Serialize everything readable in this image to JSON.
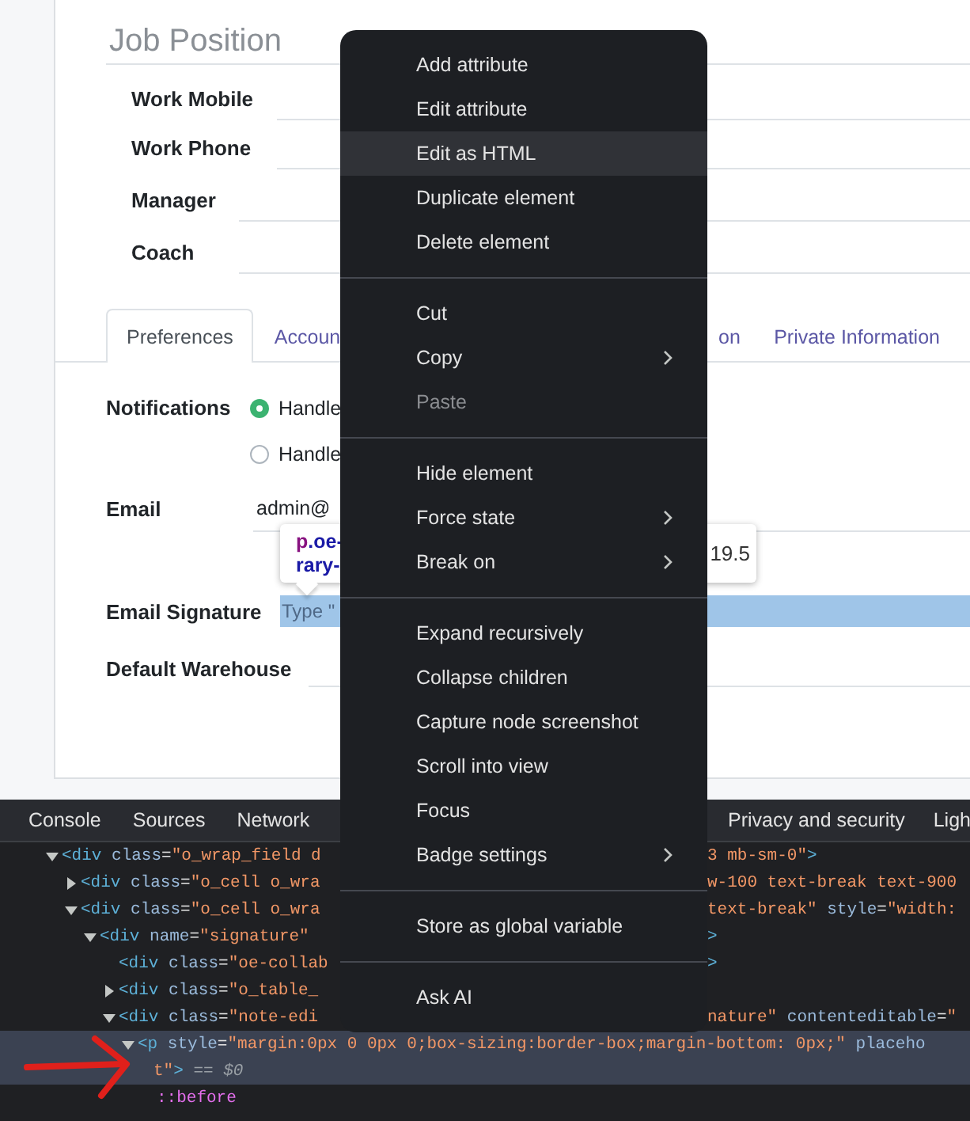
{
  "form": {
    "job_position": {
      "placeholder": "Job Position"
    },
    "contact_fields": [
      {
        "label": "Work Mobile"
      },
      {
        "label": "Work Phone"
      }
    ],
    "manager_fields": [
      {
        "label": "Manager"
      },
      {
        "label": "Coach"
      }
    ],
    "tabs": [
      {
        "label": "Preferences",
        "selected": true
      },
      {
        "label": "Accoun",
        "selected": false
      }
    ],
    "tabs_past_menu": [
      {
        "label": "on",
        "selected": false
      },
      {
        "label": "Private Information",
        "selected": false
      }
    ],
    "preferences": [
      {
        "kind": "radio",
        "label": "Notifications",
        "options": [
          {
            "label": "Handle",
            "selected": true
          },
          {
            "label": "Handle",
            "selected": false
          }
        ]
      },
      {
        "kind": "text",
        "label": "Email",
        "value": "admin@"
      },
      {
        "kind": "html",
        "label": "Email Signature",
        "placeholder": "Type \"",
        "highlighted": true
      },
      {
        "kind": "select",
        "label": "Default Warehouse"
      }
    ]
  },
  "tooltip": {
    "lines": [
      [
        {
          "kind": "tag",
          "text": "p"
        },
        {
          "kind": "class",
          "text": ".oe-"
        }
      ],
      [
        {
          "kind": "class",
          "text": "rary-"
        }
      ]
    ],
    "size_text": "19.5"
  },
  "devtools": {
    "tabs": [
      {
        "label": "Console"
      },
      {
        "label": "Sources"
      },
      {
        "label": "Network"
      }
    ],
    "tabs_past_menu": [
      {
        "label": "Privacy and security"
      },
      {
        "label": "Ligh"
      }
    ],
    "nodes": [
      {
        "kind": "parent",
        "expanded": true,
        "selected": false,
        "left": [
          {
            "kind": "tag",
            "text": "<div"
          },
          {
            "kind": "attr",
            "text": " class"
          },
          {
            "kind": "plain",
            "text": "="
          },
          {
            "kind": "value",
            "text": "\"o_wrap_field d"
          }
        ],
        "right": [
          {
            "kind": "value",
            "text": "3 mb-sm-0\""
          },
          {
            "kind": "tag",
            "text": ">"
          }
        ],
        "children": [
          {
            "kind": "parent",
            "expanded": false,
            "selected": false,
            "left": [
              {
                "kind": "tag",
                "text": "<div"
              },
              {
                "kind": "attr",
                "text": " class"
              },
              {
                "kind": "plain",
                "text": "="
              },
              {
                "kind": "value",
                "text": "\"o_cell o_wra"
              }
            ],
            "right": [
              {
                "kind": "value",
                "text": "w-100 text-break text-900"
              }
            ]
          },
          {
            "kind": "parent",
            "expanded": true,
            "selected": false,
            "left": [
              {
                "kind": "tag",
                "text": "<div"
              },
              {
                "kind": "attr",
                "text": " class"
              },
              {
                "kind": "plain",
                "text": "="
              },
              {
                "kind": "value",
                "text": "\"o_cell o_wra"
              }
            ],
            "right": [
              {
                "kind": "value",
                "text": "text-break\""
              },
              {
                "kind": "attr",
                "text": " style"
              },
              {
                "kind": "plain",
                "text": "="
              },
              {
                "kind": "value",
                "text": "\"width:"
              }
            ],
            "children": [
              {
                "kind": "parent",
                "expanded": true,
                "selected": false,
                "left": [
                  {
                    "kind": "tag",
                    "text": "<div"
                  },
                  {
                    "kind": "attr",
                    "text": " name"
                  },
                  {
                    "kind": "plain",
                    "text": "="
                  },
                  {
                    "kind": "value",
                    "text": "\"signature\""
                  }
                ],
                "right": [
                  {
                    "kind": "tag",
                    "text": ">"
                  }
                ],
                "children": [
                  {
                    "kind": "leaf",
                    "selected": false,
                    "left": [
                      {
                        "kind": "tag",
                        "text": "<div"
                      },
                      {
                        "kind": "attr",
                        "text": " class"
                      },
                      {
                        "kind": "plain",
                        "text": "="
                      },
                      {
                        "kind": "value",
                        "text": "\"oe-collab"
                      }
                    ],
                    "right": [
                      {
                        "kind": "tag",
                        "text": ">"
                      }
                    ]
                  },
                  {
                    "kind": "parent",
                    "expanded": false,
                    "selected": false,
                    "left": [
                      {
                        "kind": "tag",
                        "text": "<div"
                      },
                      {
                        "kind": "attr",
                        "text": " class"
                      },
                      {
                        "kind": "plain",
                        "text": "="
                      },
                      {
                        "kind": "value",
                        "text": "\"o_table_"
                      }
                    ]
                  },
                  {
                    "kind": "parent",
                    "expanded": true,
                    "selected": false,
                    "left": [
                      {
                        "kind": "tag",
                        "text": "<div"
                      },
                      {
                        "kind": "attr",
                        "text": " class"
                      },
                      {
                        "kind": "plain",
                        "text": "="
                      },
                      {
                        "kind": "value",
                        "text": "\"note-edi"
                      }
                    ],
                    "right": [
                      {
                        "kind": "value",
                        "text": "nature\""
                      },
                      {
                        "kind": "attr",
                        "text": " contenteditable"
                      },
                      {
                        "kind": "plain",
                        "text": "="
                      },
                      {
                        "kind": "value",
                        "text": "\""
                      }
                    ],
                    "children": [
                      {
                        "kind": "parent",
                        "expanded": true,
                        "selected": true,
                        "left": [
                          {
                            "kind": "tag",
                            "text": "<p"
                          },
                          {
                            "kind": "attr",
                            "text": " style"
                          },
                          {
                            "kind": "plain",
                            "text": "="
                          },
                          {
                            "kind": "value",
                            "text": "\"margin:0px 0 0px 0;box-sizing:border-box;margin-bottom: 0px;\""
                          },
                          {
                            "kind": "attr",
                            "text": " placeho"
                          }
                        ],
                        "wrap": [
                          {
                            "kind": "value",
                            "text": "t\""
                          },
                          {
                            "kind": "tag",
                            "text": ">"
                          },
                          {
                            "kind": "dim",
                            "text": " == $0"
                          }
                        ],
                        "children": [
                          {
                            "kind": "leaf",
                            "selected": false,
                            "left": [
                              {
                                "kind": "pseudo",
                                "text": "::before"
                              }
                            ]
                          }
                        ]
                      }
                    ]
                  }
                ]
              }
            ]
          }
        ]
      }
    ]
  },
  "context_menu": {
    "groups": [
      [
        {
          "label": "Add attribute",
          "selected": false,
          "disabled": false,
          "submenu": false
        },
        {
          "label": "Edit attribute",
          "selected": false,
          "disabled": false,
          "submenu": false
        },
        {
          "label": "Edit as HTML",
          "selected": true,
          "disabled": false,
          "submenu": false
        },
        {
          "label": "Duplicate element",
          "selected": false,
          "disabled": false,
          "submenu": false
        },
        {
          "label": "Delete element",
          "selected": false,
          "disabled": false,
          "submenu": false
        }
      ],
      [
        {
          "label": "Cut",
          "selected": false,
          "disabled": false,
          "submenu": false
        },
        {
          "label": "Copy",
          "selected": false,
          "disabled": false,
          "submenu": true
        },
        {
          "label": "Paste",
          "selected": false,
          "disabled": true,
          "submenu": false
        }
      ],
      [
        {
          "label": "Hide element",
          "selected": false,
          "disabled": false,
          "submenu": false
        },
        {
          "label": "Force state",
          "selected": false,
          "disabled": false,
          "submenu": true
        },
        {
          "label": "Break on",
          "selected": false,
          "disabled": false,
          "submenu": true
        }
      ],
      [
        {
          "label": "Expand recursively",
          "selected": false,
          "disabled": false,
          "submenu": false
        },
        {
          "label": "Collapse children",
          "selected": false,
          "disabled": false,
          "submenu": false
        },
        {
          "label": "Capture node screenshot",
          "selected": false,
          "disabled": false,
          "submenu": false
        },
        {
          "label": "Scroll into view",
          "selected": false,
          "disabled": false,
          "submenu": false
        },
        {
          "label": "Focus",
          "selected": false,
          "disabled": false,
          "submenu": false
        },
        {
          "label": "Badge settings",
          "selected": false,
          "disabled": false,
          "submenu": true
        }
      ],
      [
        {
          "label": "Store as global variable",
          "selected": false,
          "disabled": false,
          "submenu": false
        }
      ],
      [
        {
          "label": "Ask AI",
          "selected": false,
          "disabled": false,
          "submenu": false
        }
      ]
    ]
  }
}
